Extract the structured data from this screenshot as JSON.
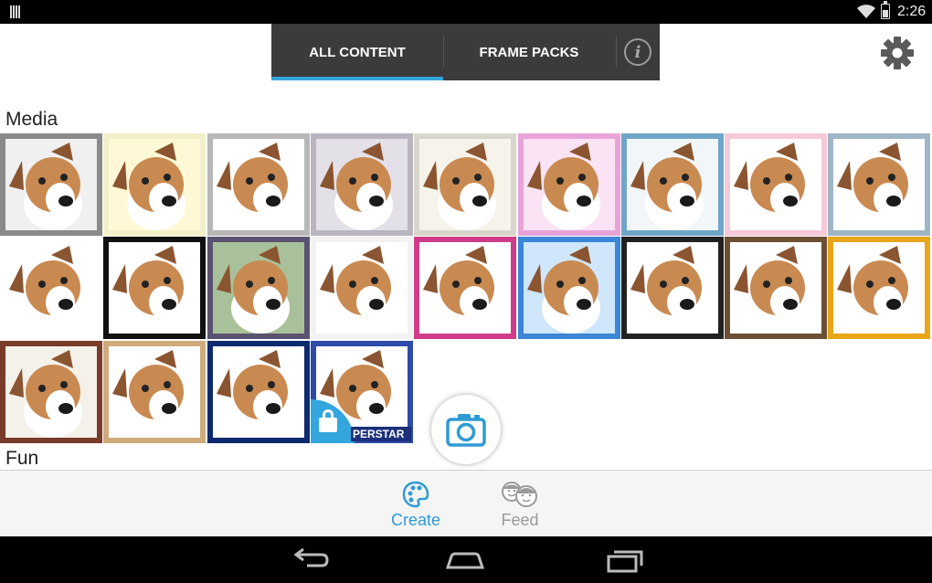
{
  "status_bar": {
    "time": "2:26",
    "icons": [
      "notification-icon",
      "wifi-icon",
      "battery-icon"
    ]
  },
  "tabs": [
    {
      "label": "ALL CONTENT",
      "active": true
    },
    {
      "label": "FRAME PACKS",
      "active": false
    }
  ],
  "info_icon": "i",
  "sections": {
    "media": "Media",
    "fun": "Fun"
  },
  "thumbnails": [
    {
      "style": "grunge",
      "bg": "#8a8a8a",
      "inner": "#f0f0f0"
    },
    {
      "style": "vintage-yellow",
      "bg": "#f3efc8",
      "inner": "#fff8d6"
    },
    {
      "style": "page-curl",
      "bg": "#b8b8b8",
      "inner": "#ffffff"
    },
    {
      "style": "sketch-purple",
      "bg": "#b9b4c0",
      "inner": "#e4e0e8"
    },
    {
      "style": "sepia-vignette",
      "bg": "#d9d6cc",
      "inner": "#f6f3ea"
    },
    {
      "style": "rainbow-bokeh",
      "bg": "#e8a4d8",
      "inner": "#fbe3f5"
    },
    {
      "style": "paint-drip",
      "bg": "#6fa6c8",
      "inner": "#f2f6f8"
    },
    {
      "style": "pink-stripes",
      "bg": "#f5c9d7",
      "inner": "#ffffff"
    },
    {
      "style": "blue-frame",
      "bg": "#9fb6c6",
      "inner": "#ffffff"
    },
    {
      "style": "plain-white",
      "bg": "#ffffff",
      "inner": "#ffffff"
    },
    {
      "style": "black-torn-border",
      "bg": "#111111",
      "inner": "#ffffff"
    },
    {
      "style": "green-purple-vignette",
      "bg": "#5a5270",
      "inner": "#a9c19a"
    },
    {
      "style": "goldfish",
      "bg": "#f2f2f2",
      "inner": "#ffffff"
    },
    {
      "style": "pink-glitter-frame",
      "bg": "#cf3d8a",
      "inner": "#ffffff"
    },
    {
      "style": "blue-bokeh",
      "bg": "#3b86d6",
      "inner": "#cfe6fb"
    },
    {
      "style": "film-strip",
      "bg": "#222222",
      "inner": "#ffffff"
    },
    {
      "style": "held-photo",
      "bg": "#6d4f34",
      "inner": "#ffffff"
    },
    {
      "style": "retro-tv",
      "bg": "#e9a619",
      "inner": "#ffffff"
    },
    {
      "style": "book-cover",
      "bg": "#7a3b2a",
      "inner": "#f4f1ea"
    },
    {
      "style": "postcard",
      "bg": "#cfab7c",
      "inner": "#ffffff"
    },
    {
      "style": "breaking-news",
      "bg": "#0d2a6e",
      "inner": "#ffffff"
    },
    {
      "style": "superstar",
      "bg": "#2d4aa8",
      "inner": "#ffffff",
      "locked": true,
      "caption": "PERSTAR"
    }
  ],
  "camera_button": "camera-icon",
  "bottom_nav": [
    {
      "label": "Create",
      "icon": "palette-icon",
      "active": true
    },
    {
      "label": "Feed",
      "icon": "faces-icon",
      "active": false
    }
  ],
  "colors": {
    "accent": "#33a6de",
    "tab_bg": "#3b3b3b",
    "system_bar": "#000000"
  }
}
